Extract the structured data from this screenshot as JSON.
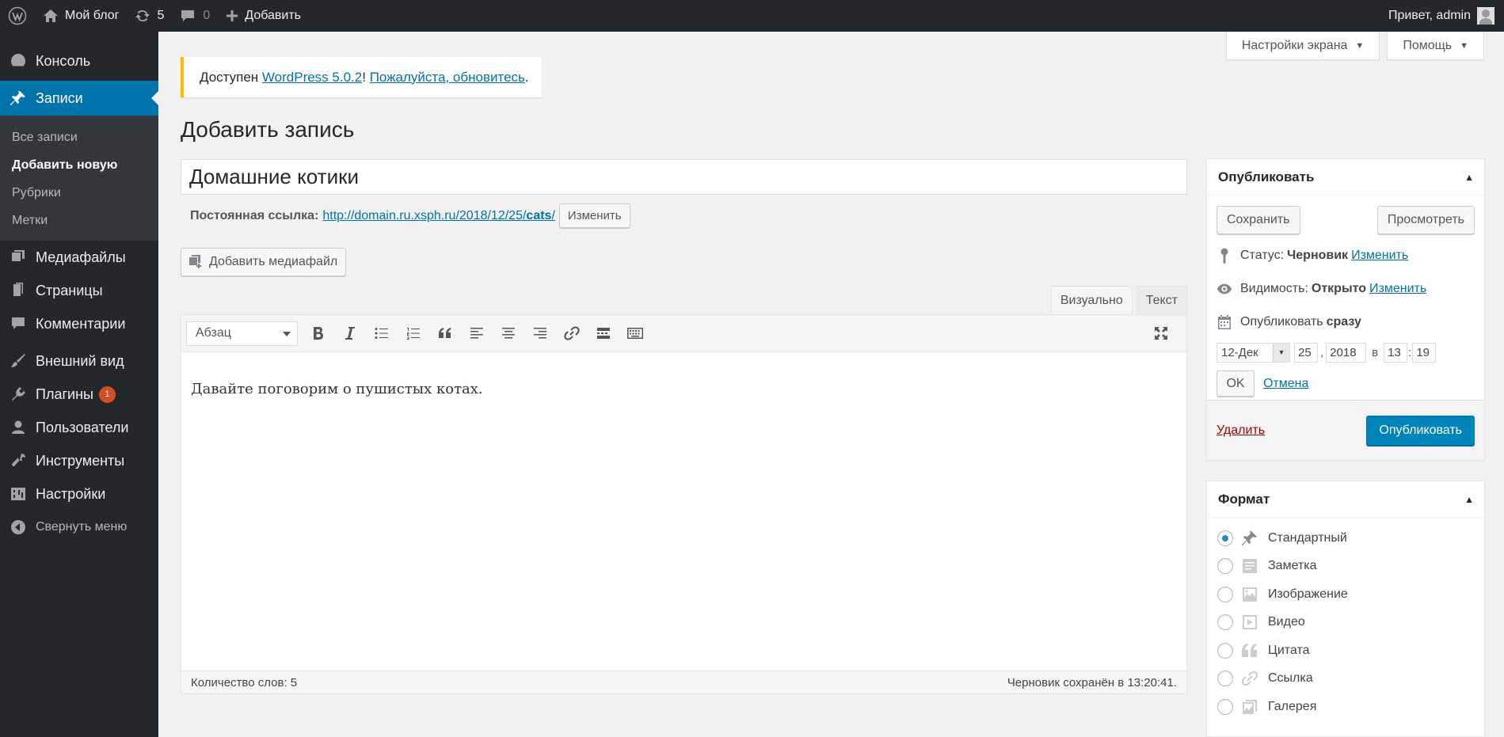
{
  "adminbar": {
    "site_name": "Мой блог",
    "updates_count": "5",
    "comments_count": "0",
    "add_new": "Добавить",
    "greeting": "Привет, admin"
  },
  "sidebar": {
    "items": [
      {
        "label": "Консоль",
        "icon": "dashboard-icon"
      },
      {
        "label": "Записи",
        "icon": "pin-icon"
      },
      {
        "label": "Медиафайлы",
        "icon": "media-icon"
      },
      {
        "label": "Страницы",
        "icon": "pages-icon"
      },
      {
        "label": "Комментарии",
        "icon": "comment-icon"
      },
      {
        "label": "Внешний вид",
        "icon": "brush-icon"
      },
      {
        "label": "Плагины",
        "icon": "plugin-icon",
        "badge": "1"
      },
      {
        "label": "Пользователи",
        "icon": "users-icon"
      },
      {
        "label": "Инструменты",
        "icon": "wrench-icon"
      },
      {
        "label": "Настройки",
        "icon": "settings-icon"
      }
    ],
    "submenu": [
      "Все записи",
      "Добавить новую",
      "Рубрики",
      "Метки"
    ],
    "collapse": "Свернуть меню"
  },
  "screen_tabs": {
    "screen_options": "Настройки экрана",
    "help": "Помощь"
  },
  "notice": {
    "prefix": "Доступен ",
    "version_link": "WordPress 5.0.2",
    "middle": "! ",
    "update_link": "Пожалуйста, обновитесь",
    "suffix": "."
  },
  "page_title": "Добавить запись",
  "post_title": "Домашние котики",
  "permalink": {
    "label": "Постоянная ссылка:",
    "url_base": "http://domain.ru.xsph.ru/2018/12/25/",
    "url_slug": "cats",
    "url_end": "/",
    "edit_button": "Изменить"
  },
  "media_button": "Добавить медиафайл",
  "editor_tabs": {
    "visual": "Визуально",
    "text": "Текст"
  },
  "format_select": "Абзац",
  "content": "Давайте поговорим о пушистых котах.",
  "status_bar": {
    "word_count": "Количество слов: 5",
    "saved": "Черновик сохранён в 13:20:41."
  },
  "publish_box": {
    "title": "Опубликовать",
    "save": "Сохранить",
    "preview": "Просмотреть",
    "status_label": "Статус:",
    "status_value": "Черновик",
    "visibility_label": "Видимость:",
    "visibility_value": "Открыто",
    "edit_link": "Изменить",
    "schedule_label": "Опубликовать",
    "schedule_value": "сразу",
    "month": "12-Дек",
    "day": "25",
    "year": "2018",
    "at": "в",
    "hour": "13",
    "minute": "19",
    "ok": "OK",
    "cancel": "Отмена",
    "delete": "Удалить",
    "publish": "Опубликовать"
  },
  "format_box": {
    "title": "Формат",
    "options": [
      {
        "label": "Стандартный",
        "checked": true,
        "icon": "pin-icon"
      },
      {
        "label": "Заметка",
        "checked": false,
        "icon": "aside-icon"
      },
      {
        "label": "Изображение",
        "checked": false,
        "icon": "image-icon"
      },
      {
        "label": "Видео",
        "checked": false,
        "icon": "video-icon"
      },
      {
        "label": "Цитата",
        "checked": false,
        "icon": "quote-icon"
      },
      {
        "label": "Ссылка",
        "checked": false,
        "icon": "link-icon"
      },
      {
        "label": "Галерея",
        "checked": false,
        "icon": "gallery-icon"
      }
    ]
  }
}
